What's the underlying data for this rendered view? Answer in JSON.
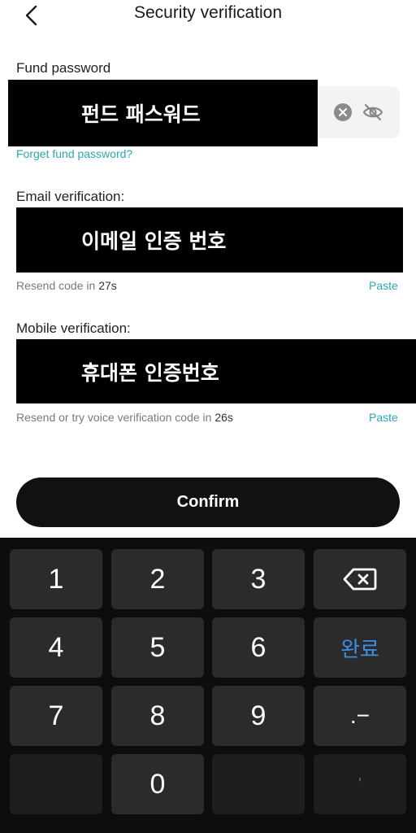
{
  "header": {
    "title": "Security verification",
    "back_icon": "chevron-left-icon"
  },
  "fund": {
    "label": "Fund password",
    "redacted_text": "펀드 패스워드",
    "forget_link": "Forget fund password?",
    "clear_icon": "clear-icon",
    "visibility_icon": "eye-off-icon"
  },
  "email": {
    "label": "Email verification:",
    "redacted_text": "이메일 인증 번호",
    "resend_prefix": "Resend code in ",
    "resend_seconds": "27s",
    "paste_label": "Paste"
  },
  "mobile": {
    "label": "Mobile verification:",
    "redacted_text": "휴대폰 인증번호",
    "resend_prefix": "Resend or try voice verification code in ",
    "resend_seconds": "26s",
    "paste_label": "Paste"
  },
  "confirm_label": "Confirm",
  "keypad": {
    "keys": [
      "1",
      "2",
      "3",
      "4",
      "5",
      "6",
      "7",
      "8",
      "9",
      "0"
    ],
    "done_label": "완료",
    "dot_minus_label": ".−",
    "apostrophe_label": "'",
    "backspace_icon": "backspace-icon"
  },
  "colors": {
    "accent": "#2aa6b8",
    "button": "#111111",
    "keypad_bg": "#0d0d0d",
    "key_bg": "#2b2b2b",
    "done": "#3d8fe6"
  }
}
